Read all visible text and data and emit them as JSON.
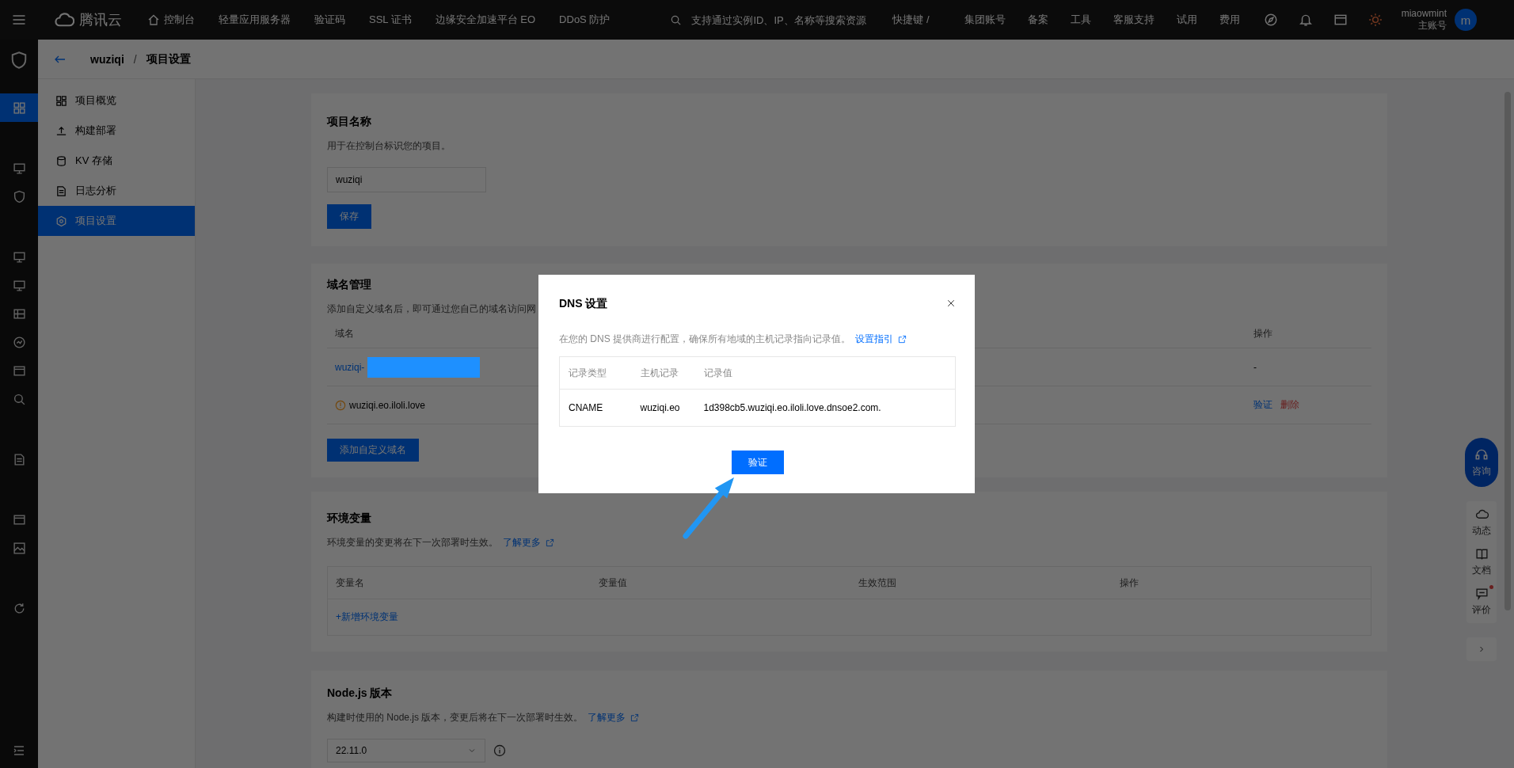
{
  "top_bar": {
    "logo": "腾讯云",
    "nav": [
      {
        "label": "控制台",
        "kind": "home"
      },
      {
        "label": "轻量应用服务器",
        "kind": "text"
      },
      {
        "label": "验证码",
        "kind": "text"
      },
      {
        "label": "SSL 证书",
        "kind": "text"
      },
      {
        "label": "边缘安全加速平台 EO",
        "kind": "text"
      },
      {
        "label": "DDoS 防护",
        "kind": "text"
      }
    ],
    "search": {
      "placeholder": "支持通过实例ID、IP、名称等搜索资源"
    },
    "shortcut": "快捷键 /",
    "links": [
      "集团账号",
      "备案",
      "工具",
      "客服支持",
      "试用",
      "费用"
    ],
    "user": {
      "name": "miaowmint",
      "role": "主账号",
      "avatar": "m"
    }
  },
  "rail": {
    "groups": [
      {
        "items": [
          {
            "selected": true
          }
        ]
      },
      {
        "items": [
          {
            "selected": false
          },
          {
            "selected": false
          }
        ]
      },
      {
        "items": [
          {
            "selected": false
          },
          {
            "selected": false
          },
          {
            "selected": false
          },
          {
            "selected": false
          },
          {
            "selected": false
          },
          {
            "selected": false
          }
        ]
      },
      {
        "items": [
          {
            "selected": false
          }
        ]
      },
      {
        "items": [
          {
            "selected": false
          },
          {
            "selected": false
          }
        ]
      },
      {
        "items": [
          {
            "selected": false
          }
        ]
      }
    ]
  },
  "breadcrumb": {
    "project": "wuziqi",
    "separator": "/",
    "page": "项目设置"
  },
  "project_nav": {
    "items": [
      {
        "label": "项目概览",
        "selected": false
      },
      {
        "label": "构建部署",
        "selected": false
      },
      {
        "label": "KV 存储",
        "selected": false
      },
      {
        "label": "日志分析",
        "selected": false
      },
      {
        "label": "项目设置",
        "selected": true
      }
    ]
  },
  "project_name": {
    "title": "项目名称",
    "description": "用于在控制台标识您的项目。",
    "value": "wuziqi",
    "button": "保存"
  },
  "domains": {
    "title": "域名管理",
    "description": "添加自定义域名后，即可通过您自己的域名访问网",
    "columns": [
      "域名",
      "操作"
    ],
    "rows": [
      {
        "domain": "wuziqi-",
        "redacted": true,
        "warning": false,
        "actions": [
          {
            "label": "-",
            "kind": "text"
          }
        ]
      },
      {
        "domain": "wuziqi.eo.iloli.love",
        "redacted": false,
        "warning": true,
        "actions": [
          {
            "label": "验证",
            "kind": "link"
          },
          {
            "label": "删除",
            "kind": "danger"
          }
        ]
      }
    ],
    "button": "添加自定义域名"
  },
  "env": {
    "title": "环境变量",
    "description": "环境变量的变更将在下一次部署时生效。",
    "link": "了解更多",
    "columns": [
      "变量名",
      "变量值",
      "生效范围",
      "操作"
    ],
    "add": "+新增环境变量"
  },
  "node": {
    "title": "Node.js 版本",
    "description": "构建时使用的 Node.js 版本，变更后将在下一次部署时生效。",
    "link": "了解更多",
    "version": "22.11.0"
  },
  "float_panel": {
    "consult": "咨询",
    "items": [
      {
        "label": "动态",
        "badge": false
      },
      {
        "label": "文档",
        "badge": false
      },
      {
        "label": "评价",
        "badge": true
      }
    ]
  },
  "dialog": {
    "title": "DNS 设置",
    "description": "在您的 DNS 提供商进行配置，确保所有地域的主机记录指向记录值。",
    "link": "设置指引",
    "columns": [
      "记录类型",
      "主机记录",
      "记录值"
    ],
    "rows": [
      [
        "CNAME",
        "wuziqi.eo",
        "1d398cb5.wuziqi.eo.iloli.love.dnsoe2.com."
      ]
    ],
    "button": "验证"
  }
}
